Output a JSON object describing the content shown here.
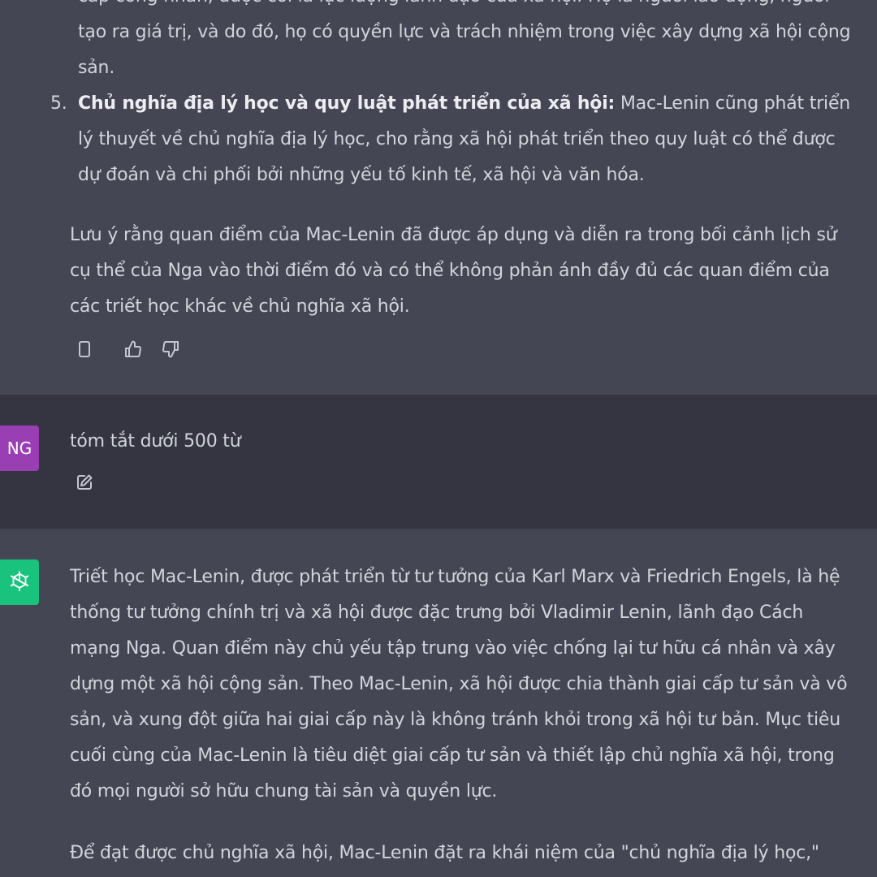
{
  "assistant_prev": {
    "clipped_top": "cấp công nhân, được coi là lực lượng lãnh đạo của xã hội. Họ là người lao động, người",
    "li4_tail_line1": "tạo ra giá trị, và do đó, họ có quyền lực và trách nhiệm trong việc xây dựng xã hội cộng",
    "li4_tail_line2": "sản.",
    "li5": {
      "number": "5.",
      "bold": "Chủ nghĩa địa lý học và quy luật phát triển của xã hội:",
      "text": " Mac-Lenin cũng phát triển lý thuyết về chủ nghĩa địa lý học, cho rằng xã hội phát triển theo quy luật có thể được dự đoán và chi phối bởi những yếu tố kinh tế, xã hội và văn hóa."
    },
    "note": "Lưu ý rằng quan điểm của Mac-Lenin đã được áp dụng và diễn ra trong bối cảnh lịch sử cụ thể của Nga vào thời điểm đó và có thể không phản ánh đầy đủ các quan điểm của các triết học khác về chủ nghĩa xã hội."
  },
  "actions": {
    "icons": [
      "clipboard-icon",
      "thumbs-up-icon",
      "thumbs-down-icon"
    ]
  },
  "user_message": {
    "avatar_initials": "NG",
    "avatar_color": "#9a3fb3",
    "text": "tóm tắt dưới 500 từ",
    "edit_icon": "edit-icon"
  },
  "assistant_reply": {
    "avatar_color": "#19c37d",
    "paragraph1": "Triết học Mac-Lenin, được phát triển từ tư tưởng của Karl Marx và Friedrich Engels, là hệ thống tư tưởng chính trị và xã hội được đặc trưng bởi Vladimir Lenin, lãnh đạo Cách mạng Nga. Quan điểm này chủ yếu tập trung vào việc chống lại tư hữu cá nhân và xây dựng một xã hội cộng sản. Theo Mac-Lenin, xã hội được chia thành giai cấp tư sản và vô sản, và xung đột giữa hai giai cấp này là không tránh khỏi trong xã hội tư bản. Mục tiêu cuối cùng của Mac-Lenin là tiêu diệt giai cấp tư sản và thiết lập chủ nghĩa xã hội, trong đó mọi người sở hữu chung tài sản và quyền lực.",
    "paragraph2_start": "Để đạt được chủ nghĩa xã hội, Mac-Lenin đặt ra khái niệm của \"chủ nghĩa địa lý học,\""
  },
  "colors": {
    "assistant_bg": "#444654",
    "user_bg": "#343541",
    "text": "#d1d5db",
    "icon": "#c5c5d2"
  }
}
